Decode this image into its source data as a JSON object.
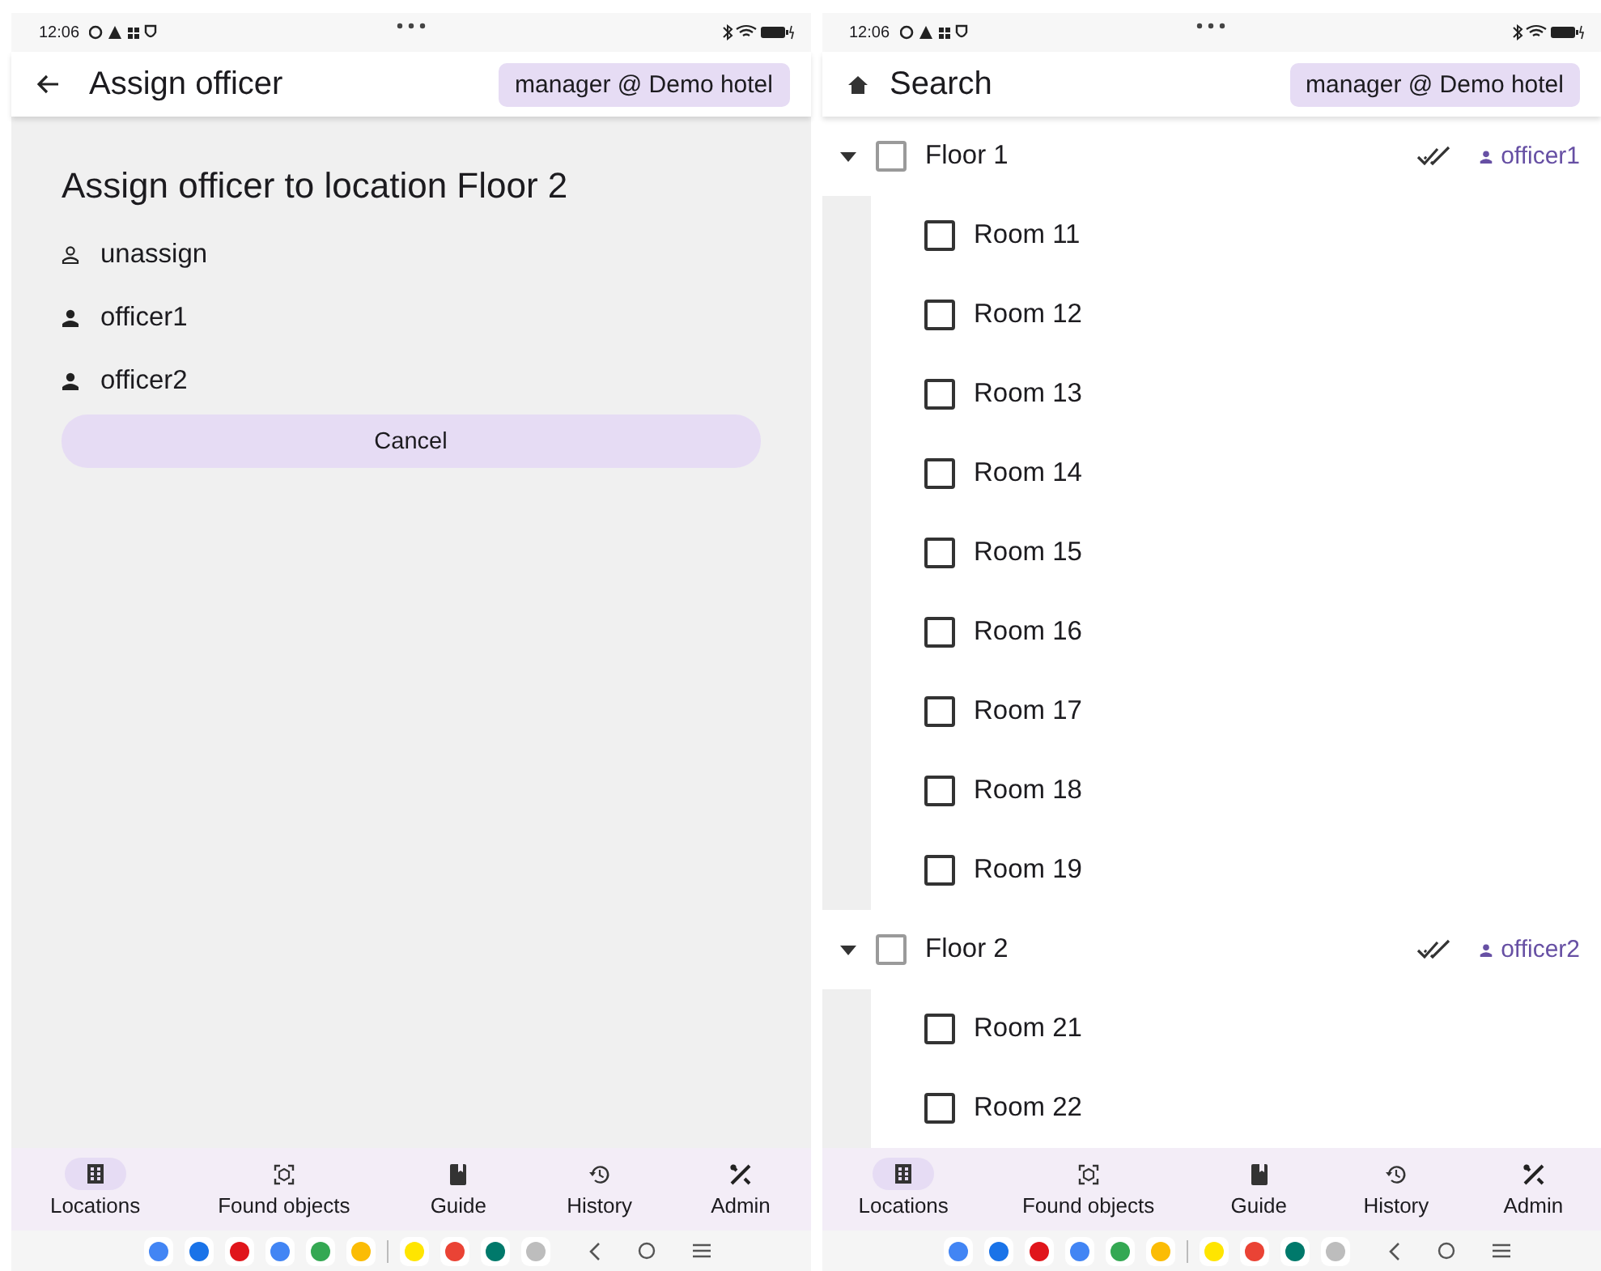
{
  "screens": [
    {
      "kind": "assign",
      "status_bar": {
        "time": "12:06"
      },
      "top_bar": {
        "title": "Assign officer",
        "account": "manager @ Demo hotel"
      },
      "dialog": {
        "title": "Assign officer to location Floor 2",
        "options": [
          {
            "kind": "unassign",
            "label": "unassign"
          },
          {
            "kind": "officer",
            "label": "officer1"
          },
          {
            "kind": "officer",
            "label": "officer2"
          }
        ],
        "cancel": "Cancel"
      },
      "bottom_nav": [
        {
          "label": "Locations",
          "selected": true
        },
        {
          "label": "Found objects",
          "selected": false
        },
        {
          "label": "Guide",
          "selected": false
        },
        {
          "label": "History",
          "selected": false
        },
        {
          "label": "Admin",
          "selected": false
        }
      ]
    },
    {
      "kind": "tree",
      "status_bar": {
        "time": "12:06"
      },
      "top_bar": {
        "title": "Search",
        "account": "manager @ Demo hotel"
      },
      "tree": [
        {
          "label": "Floor 1",
          "expanded": true,
          "checked": false,
          "officer": "officer1",
          "children": [
            {
              "label": "Room 11",
              "checked": false
            },
            {
              "label": "Room 12",
              "checked": false
            },
            {
              "label": "Room 13",
              "checked": false
            },
            {
              "label": "Room 14",
              "checked": false
            },
            {
              "label": "Room 15",
              "checked": false
            },
            {
              "label": "Room 16",
              "checked": false
            },
            {
              "label": "Room 17",
              "checked": false
            },
            {
              "label": "Room 18",
              "checked": false
            },
            {
              "label": "Room 19",
              "checked": false
            }
          ]
        },
        {
          "label": "Floor 2",
          "expanded": true,
          "checked": false,
          "officer": "officer2",
          "children": [
            {
              "label": "Room 21",
              "checked": false
            },
            {
              "label": "Room 22",
              "checked": false
            }
          ]
        }
      ],
      "bottom_nav": [
        {
          "label": "Locations",
          "selected": true
        },
        {
          "label": "Found objects",
          "selected": false
        },
        {
          "label": "Guide",
          "selected": false
        },
        {
          "label": "History",
          "selected": false
        },
        {
          "label": "Admin",
          "selected": false
        }
      ]
    }
  ]
}
